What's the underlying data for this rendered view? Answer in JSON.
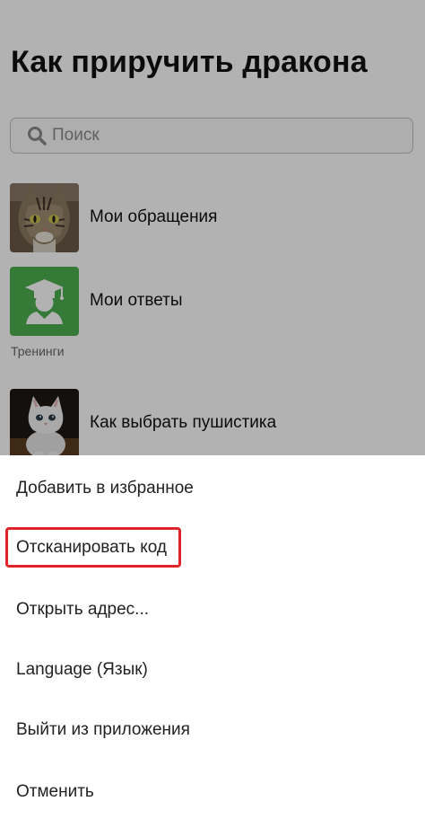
{
  "app": {
    "title": "Как приручить дракона"
  },
  "search": {
    "placeholder": "Поиск",
    "icon": "search-icon"
  },
  "list": {
    "items": [
      {
        "label": "Мои обращения",
        "thumbnail": "tabby-cat-photo"
      },
      {
        "label": "Мои ответы",
        "thumbnail": "graduate-icon",
        "color": "#4caf50"
      }
    ],
    "section_label": "Тренинги",
    "section_items": [
      {
        "label": "Как выбрать пушистика",
        "thumbnail": "white-kitten-photo"
      }
    ]
  },
  "action_sheet": {
    "items": [
      {
        "label": "Добавить в избранное"
      },
      {
        "label": "Отсканировать код",
        "highlighted": true
      },
      {
        "label": "Открыть адрес..."
      },
      {
        "label": "Language (Язык)"
      },
      {
        "label": "Выйти из приложения"
      },
      {
        "label": "Отменить"
      }
    ],
    "highlight_color": "#e0232a"
  }
}
